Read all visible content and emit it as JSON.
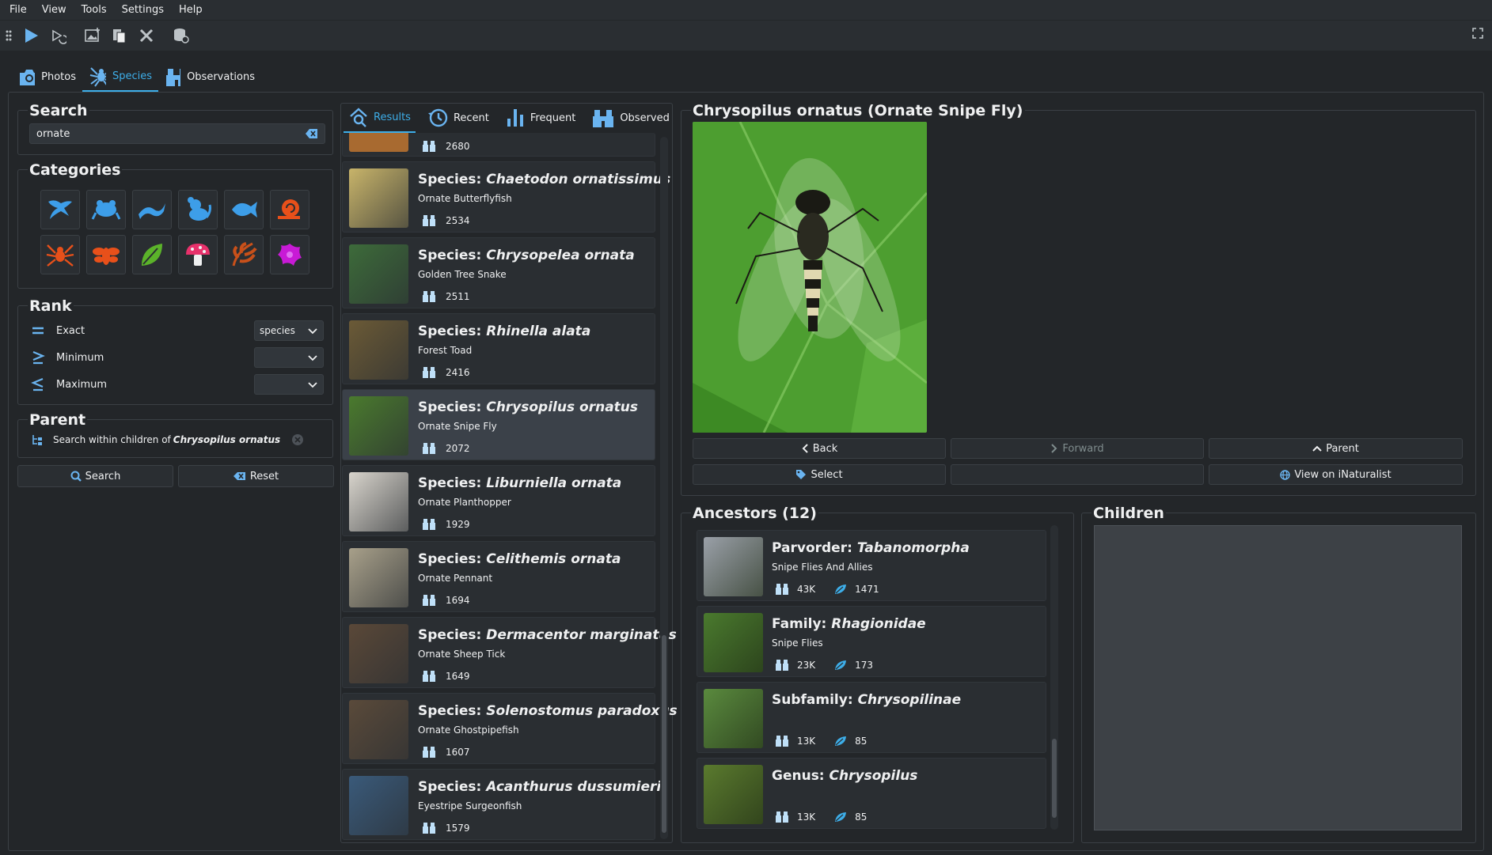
{
  "menu": [
    "File",
    "View",
    "Tools",
    "Settings",
    "Help"
  ],
  "tabs": [
    {
      "label": "Photos",
      "icon": "camera-icon"
    },
    {
      "label": "Species",
      "icon": "spider-icon"
    },
    {
      "label": "Observations",
      "icon": "binoculars-icon"
    }
  ],
  "search": {
    "title": "Search",
    "value": "ornate"
  },
  "categories": {
    "title": "Categories",
    "items": [
      {
        "icon": "bird-icon",
        "color": "#3d9ee9"
      },
      {
        "icon": "frog-icon",
        "color": "#3d9ee9"
      },
      {
        "icon": "reptile-icon",
        "color": "#3d9ee9"
      },
      {
        "icon": "mammal-icon",
        "color": "#3d9ee9"
      },
      {
        "icon": "fish-icon",
        "color": "#3d9ee9"
      },
      {
        "icon": "mollusk-icon",
        "color": "#e8501a"
      },
      {
        "icon": "arachnid-icon",
        "color": "#e8501a"
      },
      {
        "icon": "insect-icon",
        "color": "#e8501a"
      },
      {
        "icon": "plant-icon",
        "color": "#5bb32a"
      },
      {
        "icon": "fungi-icon",
        "color": "#e8316b"
      },
      {
        "icon": "chromista-icon",
        "color": "#c8501a"
      },
      {
        "icon": "protozoa-icon",
        "color": "#c81ad6"
      }
    ]
  },
  "rank": {
    "title": "Rank",
    "rows": [
      {
        "label": "Exact",
        "value": "species",
        "icon": "equals-icon"
      },
      {
        "label": "Minimum",
        "value": "",
        "icon": "greater-equal-icon"
      },
      {
        "label": "Maximum",
        "value": "",
        "icon": "less-equal-icon"
      }
    ]
  },
  "parent": {
    "title": "Parent",
    "prefix": "Search within children of ",
    "name": "Chrysopilus ornatus"
  },
  "buttons": {
    "search": "Search",
    "reset": "Reset"
  },
  "result_tabs": [
    {
      "label": "Results",
      "icon": "search-results-icon"
    },
    {
      "label": "Recent",
      "icon": "history-icon"
    },
    {
      "label": "Frequent",
      "icon": "bar-chart-icon"
    },
    {
      "label": "Observed",
      "icon": "binoculars-icon"
    }
  ],
  "results_top_count": "2680",
  "results": [
    {
      "rank": "Species:",
      "name": "Chaetodon ornatissimus",
      "common": "Ornate Butterflyfish",
      "count": "2534",
      "bg": "#c8b46a"
    },
    {
      "rank": "Species:",
      "name": "Chrysopelea ornata",
      "common": "Golden Tree Snake",
      "count": "2511",
      "bg": "#3d6b3a"
    },
    {
      "rank": "Species:",
      "name": "Rhinella alata",
      "common": "Forest Toad",
      "count": "2416",
      "bg": "#6b5a36"
    },
    {
      "rank": "Species:",
      "name": "Chrysopilus ornatus",
      "common": "Ornate Snipe Fly",
      "count": "2072",
      "bg": "#4a7a2e"
    },
    {
      "rank": "Species:",
      "name": "Liburniella ornata",
      "common": "Ornate Planthopper",
      "count": "1929",
      "bg": "#d8d4cc"
    },
    {
      "rank": "Species:",
      "name": "Celithemis ornata",
      "common": "Ornate Pennant",
      "count": "1694",
      "bg": "#a8a08a"
    },
    {
      "rank": "Species:",
      "name": "Dermacentor marginatus",
      "common": "Ornate Sheep Tick",
      "count": "1649",
      "bg": "#5a4838"
    },
    {
      "rank": "Species:",
      "name": "Solenostomus paradoxus",
      "common": "Ornate Ghostpipefish",
      "count": "1607",
      "bg": "#5a4a3a"
    },
    {
      "rank": "Species:",
      "name": "Acanthurus dussumieri",
      "common": "Eyestripe Surgeonfish",
      "count": "1579",
      "bg": "#3a5a7a"
    }
  ],
  "detail": {
    "title": "Chrysopilus ornatus (Ornate Snipe Fly)"
  },
  "nav_buttons": {
    "back": "Back",
    "forward": "Forward",
    "parent": "Parent",
    "select": "Select",
    "inat": "View on iNaturalist"
  },
  "ancestors": {
    "title": "Ancestors (12)",
    "items": [
      {
        "rank": "Parvorder:",
        "name": "Tabanomorpha",
        "common": "Snipe Flies And Allies",
        "obs": "43K",
        "leaf": "1471",
        "bg": "#9aa0a8"
      },
      {
        "rank": "Family:",
        "name": "Rhagionidae",
        "common": "Snipe Flies",
        "obs": "23K",
        "leaf": "173",
        "bg": "#4a7a2e"
      },
      {
        "rank": "Subfamily:",
        "name": "Chrysopilinae",
        "common": "",
        "obs": "13K",
        "leaf": "85",
        "bg": "#5a8a3e"
      },
      {
        "rank": "Genus:",
        "name": "Chrysopilus",
        "common": "",
        "obs": "13K",
        "leaf": "85",
        "bg": "#5a7a2e"
      }
    ]
  },
  "children": {
    "title": "Children"
  }
}
